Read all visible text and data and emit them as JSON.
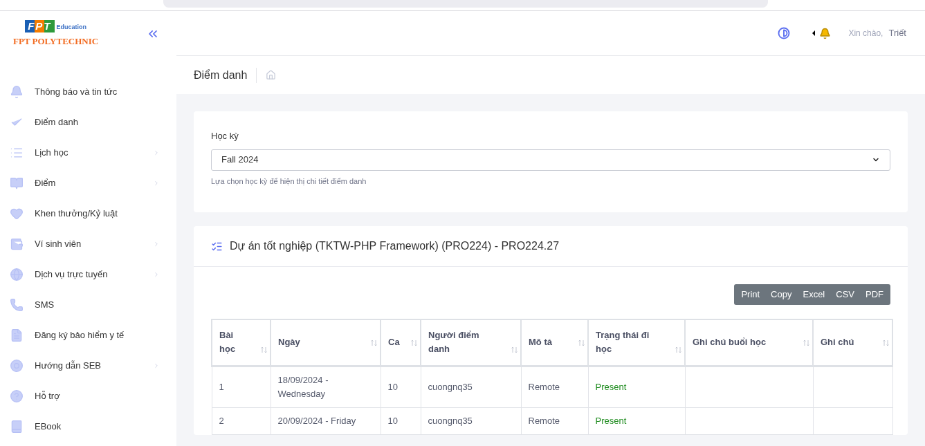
{
  "sidebar": {
    "logo": {
      "brand": "FPT",
      "sub": "Education",
      "name": "FPT POLYTECHNIC"
    },
    "items": [
      {
        "label": "Thông báo và tin tức",
        "has_submenu": false
      },
      {
        "label": "Điểm danh",
        "has_submenu": false
      },
      {
        "label": "Lịch học",
        "has_submenu": true
      },
      {
        "label": "Điểm",
        "has_submenu": true
      },
      {
        "label": "Khen thưởng/Kỷ luật",
        "has_submenu": false
      },
      {
        "label": "Ví sinh viên",
        "has_submenu": true
      },
      {
        "label": "Dịch vụ trực tuyến",
        "has_submenu": true
      },
      {
        "label": "SMS",
        "has_submenu": false
      },
      {
        "label": "Đăng ký bảo hiểm y tế",
        "has_submenu": false
      },
      {
        "label": "Hướng dẫn SEB",
        "has_submenu": true
      },
      {
        "label": "Hỗ trợ",
        "has_submenu": false
      },
      {
        "label": "EBook",
        "has_submenu": false
      }
    ]
  },
  "header": {
    "greeting": "Xin chào,",
    "user": "Triết"
  },
  "breadcrumb": {
    "title": "Điểm danh"
  },
  "semester": {
    "label": "Học kỳ",
    "value": "Fall 2024",
    "help": "Lựa chọn học kỳ để hiện thị chi tiết điểm danh"
  },
  "course": {
    "title": "Dự án tốt nghiệp (TKTW-PHP Framework) (PRO224) - PRO224.27",
    "export_buttons": [
      "Print",
      "Copy",
      "Excel",
      "CSV",
      "PDF"
    ],
    "table": {
      "columns": [
        "Bài học",
        "Ngày",
        "Ca",
        "Người điểm danh",
        "Mô tả",
        "Trạng thái đi học",
        "Ghi chú buổi học",
        "Ghi chú"
      ],
      "rows": [
        [
          "1",
          "18/09/2024 - Wednesday",
          "10",
          "cuongnq35",
          "Remote",
          "Present",
          "",
          ""
        ],
        [
          "2",
          "20/09/2024 - Friday",
          "10",
          "cuongnq35",
          "Remote",
          "Present",
          "",
          ""
        ]
      ]
    }
  }
}
